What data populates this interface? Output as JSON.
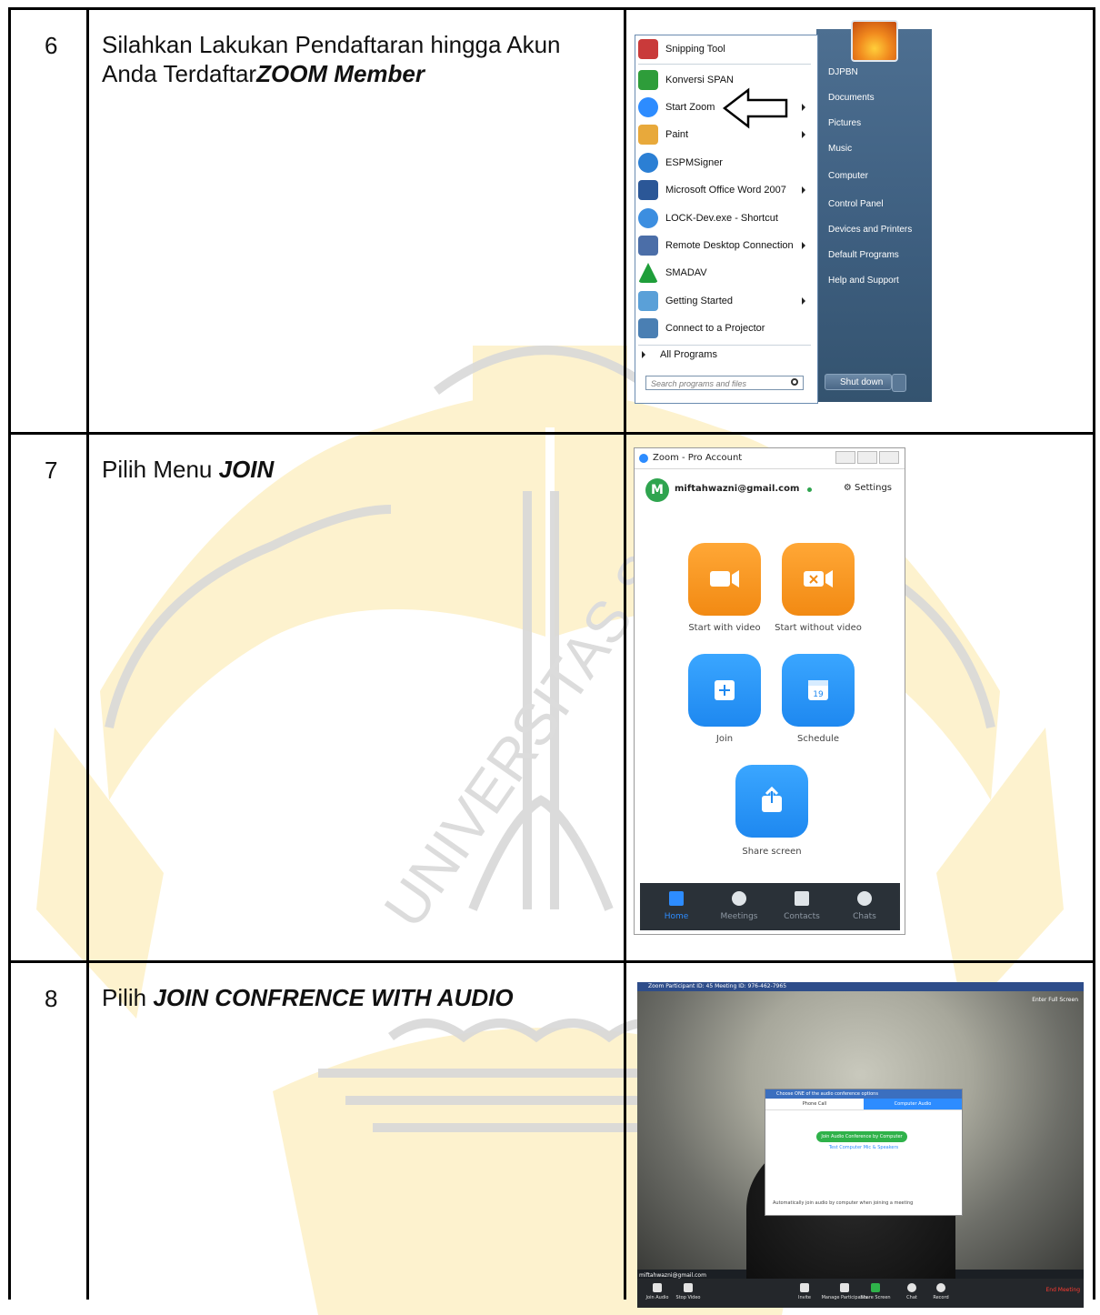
{
  "rows": [
    {
      "number": "6",
      "text_plain": "Silahkan Lakukan Pendaftaran hingga Akun Anda Terdaftar",
      "text_emph": "ZOOM Member"
    },
    {
      "number": "7",
      "text_plain": "Pilih Menu ",
      "text_emph": "JOIN"
    },
    {
      "number": "8",
      "text_plain": "Pilih ",
      "text_emph": "JOIN CONFRENCE WITH AUDIO"
    }
  ],
  "start_menu": {
    "programs": [
      {
        "label": "Snipping Tool",
        "icon": "scissors-icon",
        "color": "#c93a3a"
      },
      {
        "label": "Konversi SPAN",
        "icon": "k-logo-icon",
        "color": "#2e9d3a"
      },
      {
        "label": "Start Zoom",
        "icon": "zoom-icon",
        "color": "#2d8cff"
      },
      {
        "label": "Paint",
        "icon": "palette-icon",
        "color": "#e8a93b"
      },
      {
        "label": "ESPMSigner",
        "icon": "browser-icon",
        "color": "#2b7fd4"
      },
      {
        "label": "Microsoft Office Word 2007",
        "icon": "word-icon",
        "color": "#2b5797"
      },
      {
        "label": "LOCK-Dev.exe - Shortcut",
        "icon": "lock-app-icon",
        "color": "#3c8ee0"
      },
      {
        "label": "Remote Desktop Connection",
        "icon": "remote-desktop-icon",
        "color": "#4b6ea8"
      },
      {
        "label": "SMADAV",
        "icon": "smadav-icon",
        "color": "#1f9e3a"
      },
      {
        "label": "Getting Started",
        "icon": "getting-started-icon",
        "color": "#5aa0d8"
      },
      {
        "label": "Connect to a Projector",
        "icon": "projector-icon",
        "color": "#4a7fb3"
      }
    ],
    "all_programs": "All Programs",
    "search_placeholder": "Search programs and files",
    "right_items": [
      "DJPBN",
      "Documents",
      "Pictures",
      "Music",
      "Computer",
      "Control Panel",
      "Devices and Printers",
      "Default Programs",
      "Help and Support"
    ],
    "shutdown": "Shut down"
  },
  "zoom": {
    "title": "Zoom - Pro Account",
    "avatar_letter": "M",
    "email": "miftahwazni@gmail.com",
    "settings": "Settings",
    "buttons": [
      "Start with video",
      "Start without video",
      "Join",
      "Schedule",
      "Share screen"
    ],
    "calendar_day": "19",
    "nav": [
      "Home",
      "Meetings",
      "Contacts",
      "Chats"
    ]
  },
  "meeting": {
    "title": "Zoom Participant ID: 45   Meeting ID: 976-462-7965",
    "full_screen": "Enter Full Screen",
    "dialog_title": "Choose ONE of the audio conference options",
    "tab_phone": "Phone Call",
    "tab_computer": "Computer Audio",
    "join_audio": "Join Audio Conference by Computer",
    "test_audio": "Test Computer Mic & Speakers",
    "auto_join": "Automatically join audio by computer when joining a meeting",
    "email": "miftahwazni@gmail.com",
    "toolbar": [
      "Join Audio",
      "Stop Video",
      "Invite",
      "Manage Participants",
      "Share Screen",
      "Chat",
      "Record"
    ],
    "participants_count": "1",
    "end_meeting": "End Meeting"
  },
  "watermark_text": "UNIVERSITAS S"
}
